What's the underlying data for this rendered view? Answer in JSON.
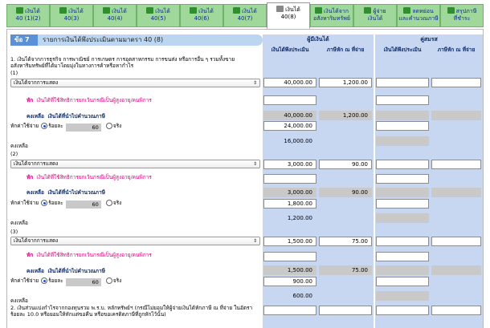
{
  "tabs": [
    {
      "line1": "เงินได้",
      "line2": "40 (1)(2)",
      "active": false
    },
    {
      "line1": "เงินได้",
      "line2": "40(3)",
      "active": false
    },
    {
      "line1": "เงินได้",
      "line2": "40(4)",
      "active": false
    },
    {
      "line1": "เงินได้",
      "line2": "40(5)",
      "active": false
    },
    {
      "line1": "เงินได้",
      "line2": "40(6)",
      "active": false
    },
    {
      "line1": "เงินได้",
      "line2": "40(7)",
      "active": false
    },
    {
      "line1": "เงินได้",
      "line2": "40(8)",
      "active": true
    },
    {
      "line1": "เงินได้จาก",
      "line2": "อสังหาริมทรัพย์",
      "active": false
    },
    {
      "line1": "ผู้จ่าย",
      "line2": "เงินได้",
      "active": false
    },
    {
      "line1": "ลดหย่อน",
      "line2": "และคำนวณภาษี",
      "active": false
    },
    {
      "line1": "สรุปภาษี",
      "line2": "ที่ชำระ",
      "active": false
    }
  ],
  "section": {
    "number": "ข้อ 7",
    "title": "รายการเงินได้พึงประเมินตามมาตรา 40 (8)"
  },
  "columns": {
    "taxpayer": "ผู้มีเงินได้",
    "spouse": "คู่สมรส",
    "income": "เงินได้พึงประเมิน",
    "withheld": "ภาษีหัก ณ ที่จ่าย"
  },
  "item1_desc": "1. เงินได้จากการธุรกิจ การพาณิชย์ การเกษตร การอุตสาหกรรม การขนส่ง หรือการอื่น ๆ รวมทั้งขายอสังหาริมทรัพย์ที่ได้มาโดยมุ่งในทางการค้าหรือหากำไร",
  "item2_desc": "2. เงินส่วนแบ่งกำไรจากกองทุนรวม พ.ร.บ. หลักทรัพย์ฯ (กรณีไม่ยอมให้ผู้จ่ายเงินได้หักภาษี ณ ที่จ่าย ในอัตราร้อยละ 10.0 หรือยอมให้หักแต่ขอคืน หรือขอเครดิตภาษีที่ถูกหักไว้นั้น)",
  "labels": {
    "deduct_label": "หัก",
    "deduct_text": "เงินได้ที่ใช้สิทธิการยกเว้นกรณีเป็นผู้สูงอายุ/คนพิการ",
    "remain_label": "คงเหลือ",
    "remain_text": "เงินได้ที่นำไปคำนวณภาษี",
    "expense_label": "หักค่าใช้จ่าย",
    "rate_label": "ร้อยละ",
    "actual_label": "จริง",
    "remain2": "คงเหลือ"
  },
  "entries": [
    {
      "marker": "(1)",
      "select": "เงินได้จากการแสดง",
      "income": "40,000.00",
      "withheld": "1,200.00",
      "taxable_income": "40,000.00",
      "taxable_withheld": "1,200.00",
      "rate": "60",
      "expense": "24,000.00",
      "net": "16,000.00"
    },
    {
      "marker": "(2)",
      "select": "เงินได้จากการแสดง",
      "income": "3,000.00",
      "withheld": "90.00",
      "taxable_income": "3,000.00",
      "taxable_withheld": "90.00",
      "rate": "60",
      "expense": "1,800.00",
      "net": "1,200.00"
    },
    {
      "marker": "(3)",
      "select": "เงินได้จากการแสดง",
      "income": "1,500.00",
      "withheld": "75.00",
      "taxable_income": "1,500.00",
      "taxable_withheld": "75.00",
      "rate": "60",
      "expense": "900.00",
      "net": "600.00"
    }
  ]
}
